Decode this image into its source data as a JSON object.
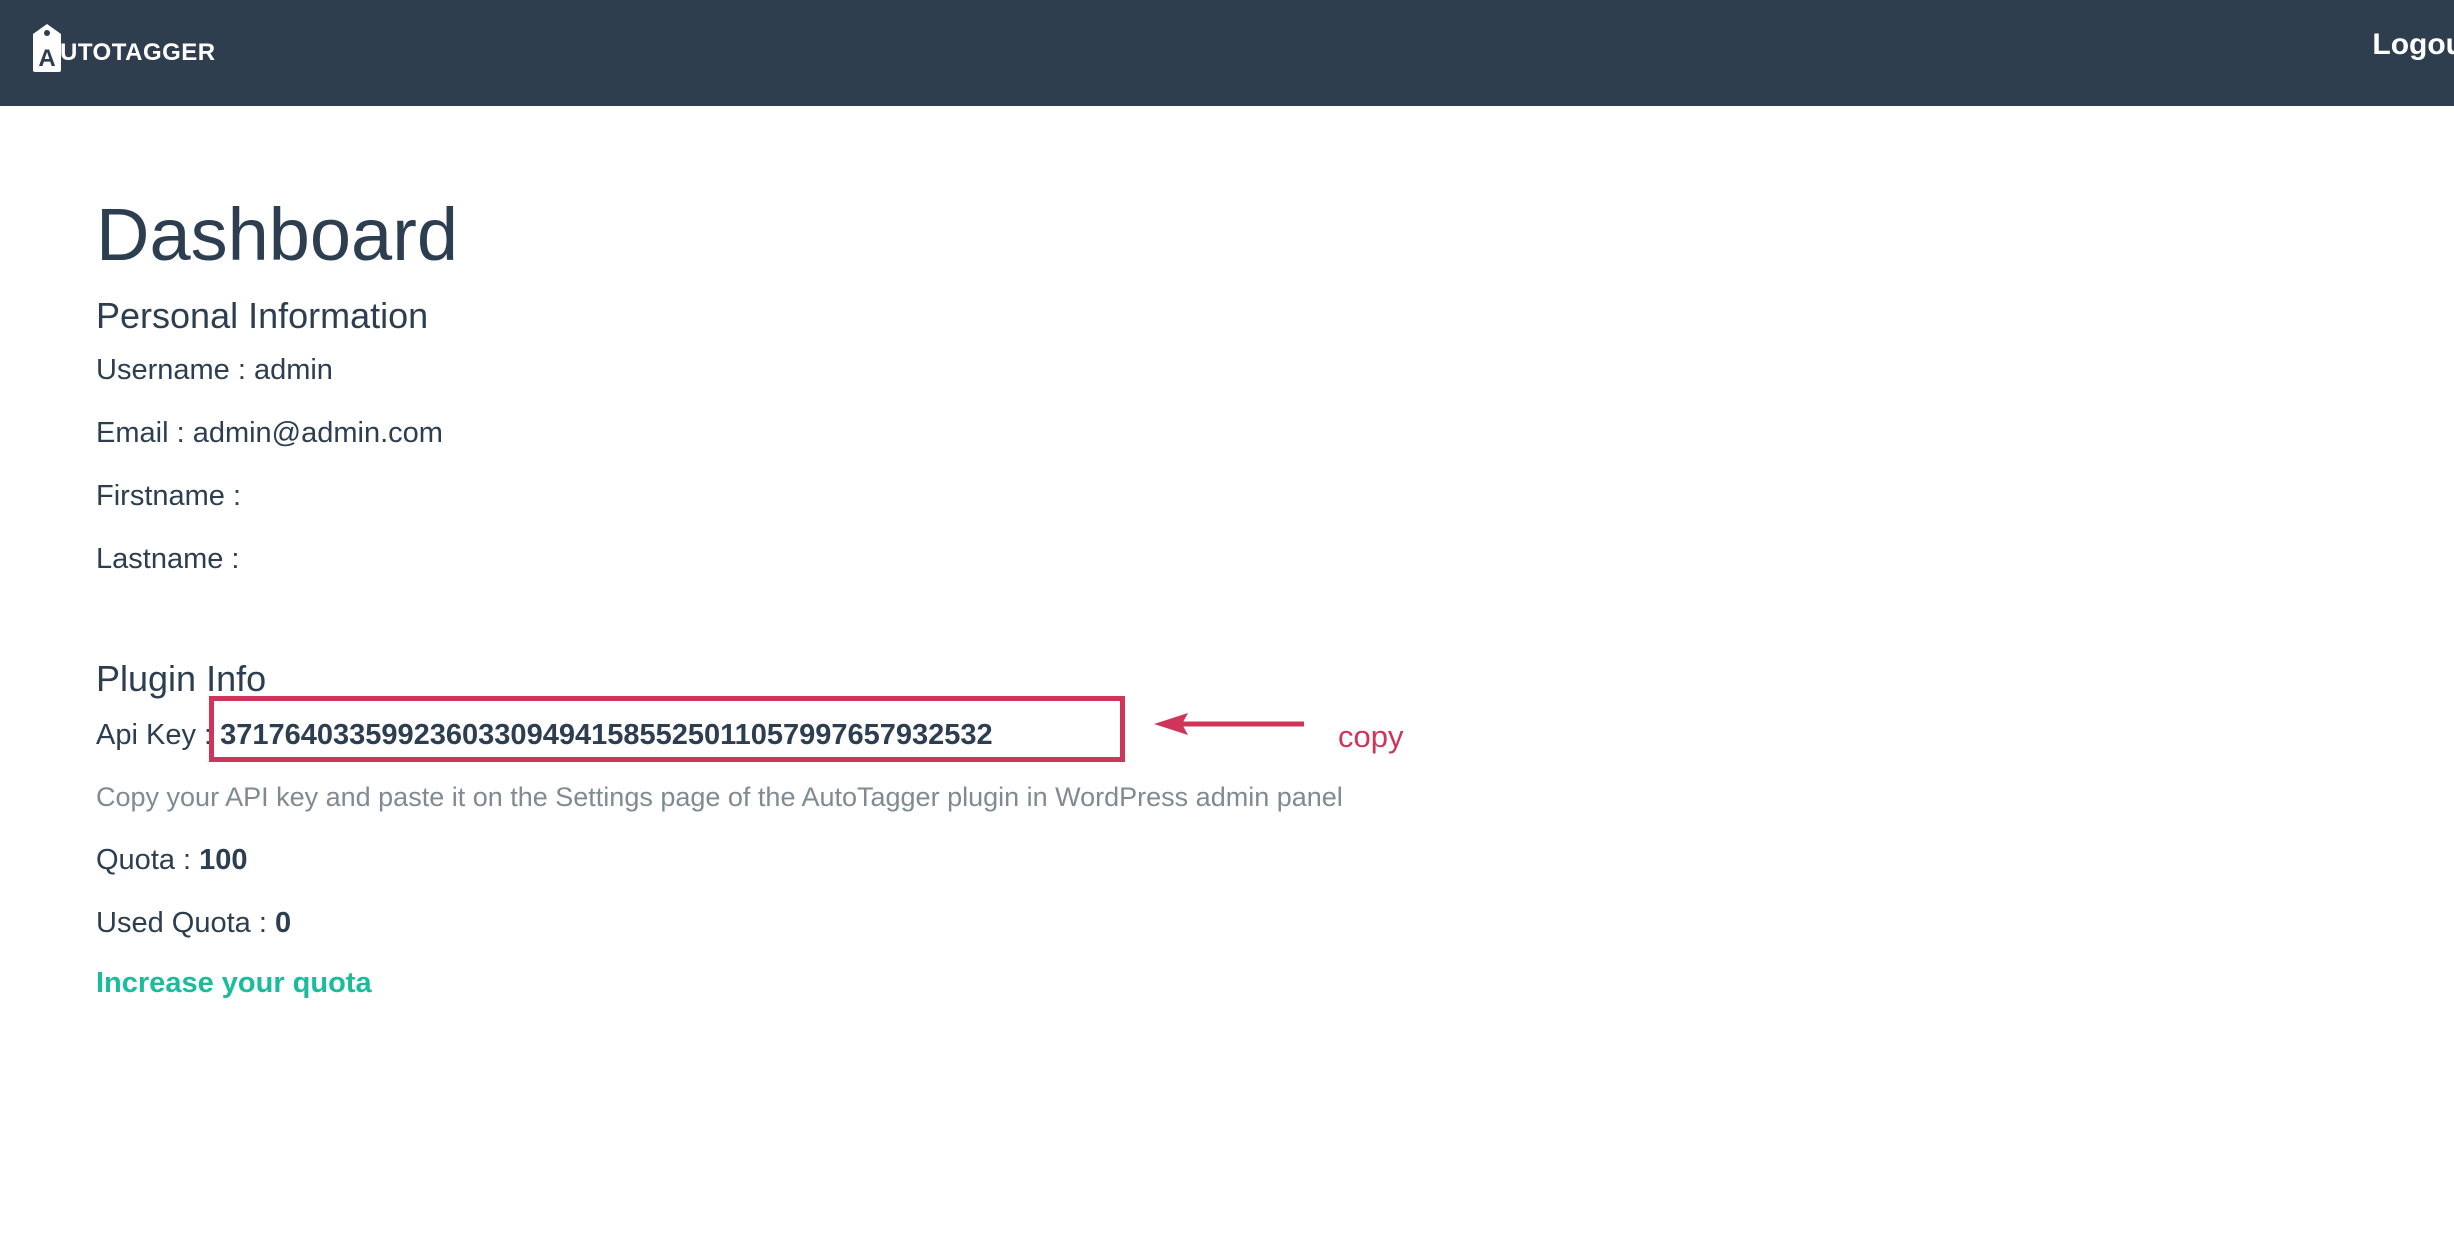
{
  "navbar": {
    "brand_initial": "A",
    "brand_text": "UTOTAGGER",
    "logout_label": "Logout"
  },
  "main": {
    "title": "Dashboard",
    "personal": {
      "heading": "Personal Information",
      "username_label": "Username : ",
      "username_value": "admin",
      "email_label": "Email : ",
      "email_value": "admin@admin.com",
      "firstname_label": "Firstname : ",
      "firstname_value": "",
      "lastname_label": "Lastname : ",
      "lastname_value": ""
    },
    "plugin": {
      "heading": "Plugin Info",
      "api_key_label": "Api Key : ",
      "api_key_value": "37176403359923603309494158552501105799765793253​2",
      "help_text": "Copy your API key and paste it on the Settings page of the AutoTagger plugin in WordPress admin panel",
      "quota_label": "Quota : ",
      "quota_value": "100",
      "used_quota_label": "Used Quota : ",
      "used_quota_value": "0",
      "increase_link": "Increase your quota"
    },
    "annotation": {
      "note": "copy",
      "color": "#d1345b"
    }
  },
  "colors": {
    "navbar": "#2f3e4e",
    "text": "#2c3e50",
    "link": "#1abc9c",
    "muted": "#7f8a93"
  }
}
